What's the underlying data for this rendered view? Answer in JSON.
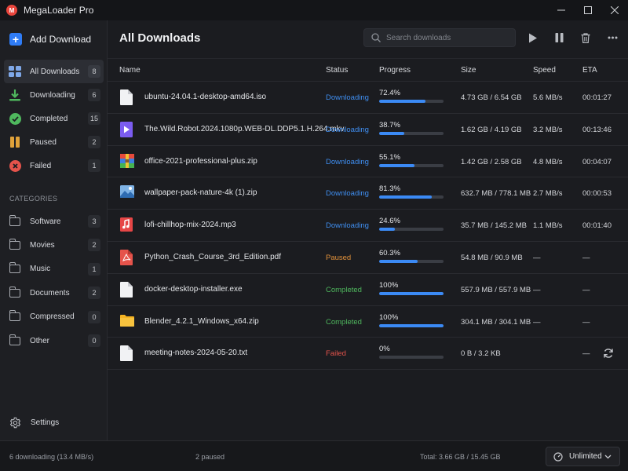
{
  "app": {
    "title": "MegaLoader Pro",
    "logo_letter": "M"
  },
  "window_controls": {
    "minimize": "—",
    "maximize": "☐",
    "close": "✕"
  },
  "sidebar": {
    "add_label": "Add Download",
    "nav": [
      {
        "label": "All Downloads",
        "count": "8",
        "icon": "grid-icon"
      },
      {
        "label": "Downloading",
        "count": "6",
        "icon": "download-arrow-icon"
      },
      {
        "label": "Completed",
        "count": "15",
        "icon": "check-circle-icon"
      },
      {
        "label": "Paused",
        "count": "2",
        "icon": "pause-icon"
      },
      {
        "label": "Failed",
        "count": "1",
        "icon": "error-circle-icon"
      }
    ],
    "categories_heading": "CATEGORIES",
    "categories": [
      {
        "label": "Software",
        "count": "3"
      },
      {
        "label": "Movies",
        "count": "2"
      },
      {
        "label": "Music",
        "count": "1"
      },
      {
        "label": "Documents",
        "count": "2"
      },
      {
        "label": "Compressed",
        "count": "0"
      },
      {
        "label": "Other",
        "count": "0"
      }
    ],
    "settings_label": "Settings"
  },
  "main": {
    "title": "All Downloads",
    "search_placeholder": "Search downloads",
    "columns": {
      "name": "Name",
      "status": "Status",
      "progress": "Progress",
      "size": "Size",
      "speed": "Speed",
      "eta": "ETA"
    },
    "rows": [
      {
        "name": "ubuntu-24.04.1-desktop-amd64.iso",
        "status": "Downloading",
        "progress": "72.4%",
        "fraction": 0.724,
        "size": "4.73 GB / 6.54 GB",
        "speed": "5.6 MB/s",
        "eta": "00:01:27",
        "icon": "file-icon"
      },
      {
        "name": "The.Wild.Robot.2024.1080p.WEB-DL.DDP5.1.H.264.mkv",
        "status": "Downloading",
        "progress": "38.7%",
        "fraction": 0.387,
        "size": "1.62 GB / 4.19 GB",
        "speed": "3.2 MB/s",
        "eta": "00:13:46",
        "icon": "video-icon"
      },
      {
        "name": "office-2021-professional-plus.zip",
        "status": "Downloading",
        "progress": "55.1%",
        "fraction": 0.551,
        "size": "1.42 GB / 2.58 GB",
        "speed": "4.8 MB/s",
        "eta": "00:04:07",
        "icon": "archive-icon"
      },
      {
        "name": "wallpaper-pack-nature-4k (1).zip",
        "status": "Downloading",
        "progress": "81.3%",
        "fraction": 0.813,
        "size": "632.7 MB / 778.1 MB",
        "speed": "2.7 MB/s",
        "eta": "00:00:53",
        "icon": "image-icon"
      },
      {
        "name": "lofi-chillhop-mix-2024.mp3",
        "status": "Downloading",
        "progress": "24.6%",
        "fraction": 0.246,
        "size": "35.7 MB / 145.2 MB",
        "speed": "1.1 MB/s",
        "eta": "00:01:40",
        "icon": "music-icon"
      },
      {
        "name": "Python_Crash_Course_3rd_Edition.pdf",
        "status": "Paused",
        "progress": "60.3%",
        "fraction": 0.603,
        "size": "54.8 MB / 90.9 MB",
        "speed": "—",
        "eta": "—",
        "icon": "pdf-icon"
      },
      {
        "name": "docker-desktop-installer.exe",
        "status": "Completed",
        "progress": "100%",
        "fraction": 1.0,
        "size": "557.9 MB / 557.9 MB",
        "speed": "—",
        "eta": "—",
        "icon": "file-icon"
      },
      {
        "name": "Blender_4.2.1_Windows_x64.zip",
        "status": "Completed",
        "progress": "100%",
        "fraction": 1.0,
        "size": "304.1 MB / 304.1 MB",
        "speed": "—",
        "eta": "—",
        "icon": "folder-icon"
      },
      {
        "name": "meeting-notes-2024-05-20.txt",
        "status": "Failed",
        "progress": "0%",
        "fraction": 0.0,
        "size": "0 B / 3.2 KB",
        "speed": "",
        "eta": "—",
        "icon": "file-icon",
        "retry": true
      }
    ]
  },
  "status_colors": {
    "Downloading": "#3f8ef0",
    "Paused": "#e0903a",
    "Completed": "#4fb85e",
    "Failed": "#e5534b"
  },
  "statusbar": {
    "downloading": "6 downloading (13.4 MB/s)",
    "paused": "2 paused",
    "total": "Total: 3.66 GB / 15.45 GB",
    "limit_label": "Unlimited"
  }
}
